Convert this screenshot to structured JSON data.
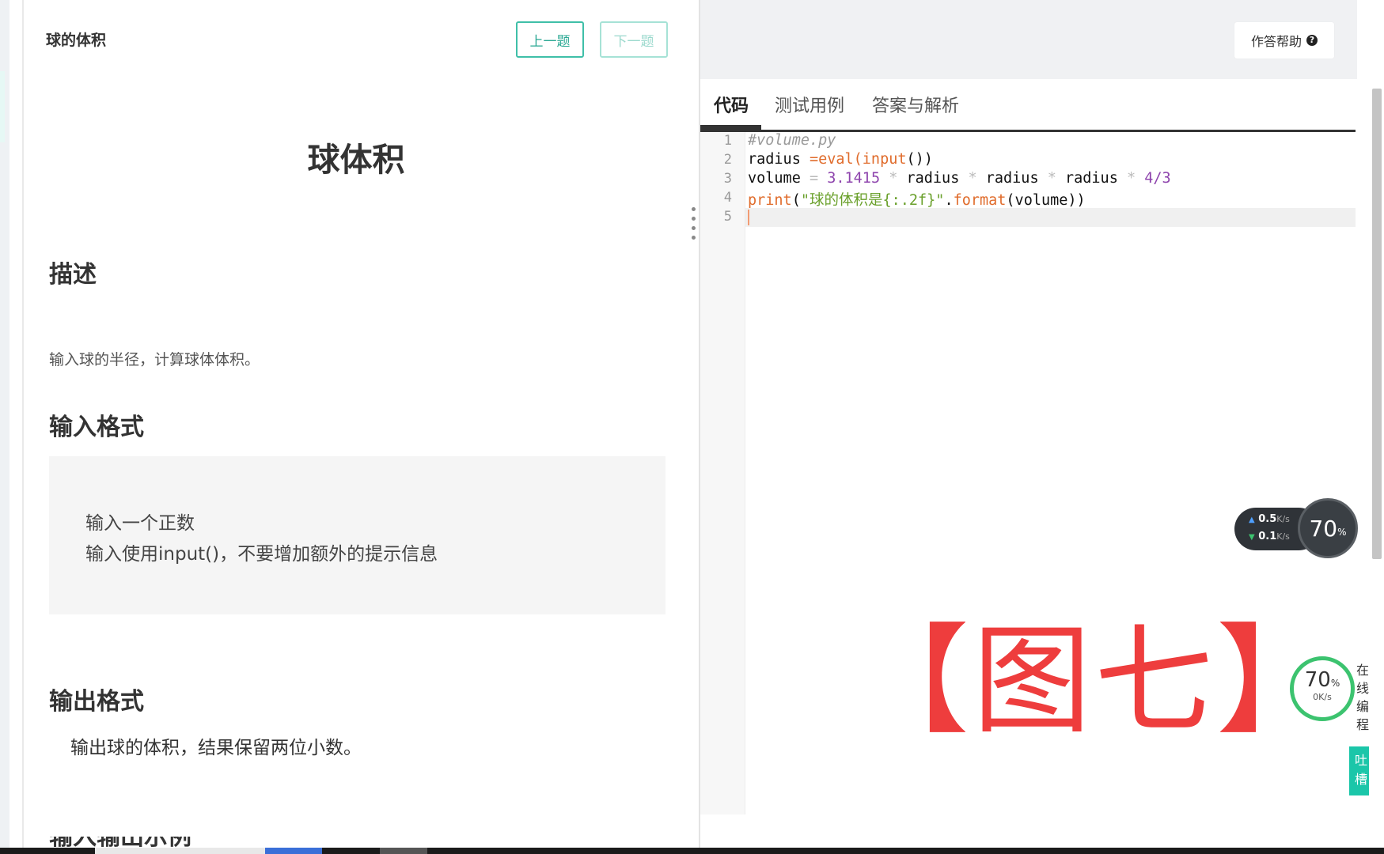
{
  "left": {
    "problem_title": "球的体积",
    "prev_label": "上一题",
    "next_label": "下一题",
    "content_title": "球体积",
    "desc_heading": "描述",
    "desc_text": "输入球的半径，计算球体体积。",
    "input_heading": "输入格式",
    "input_lines": [
      "输入一个正数",
      "输入使用input()，不要增加额外的提示信息"
    ],
    "output_heading": "输出格式",
    "output_text": "输出球的体积，结果保留两位小数。",
    "cut_heading": "输入输出示例"
  },
  "right": {
    "help_label": "作答帮助",
    "help_icon": "question-circle-icon",
    "tabs": [
      "代码",
      "测试用例",
      "答案与解析"
    ],
    "active_tab": 0,
    "line_numbers": [
      "1",
      "2",
      "3",
      "4",
      "5"
    ],
    "code": {
      "l1": "#volume.py",
      "l2_a": "radius ",
      "l2_b": "=eval(",
      "l2_c": "input",
      "l2_d": "())",
      "l3_a": "volume ",
      "l3_b": "= ",
      "l3_c": "3.1415",
      "l3_d": " * ",
      "l3_e": "radius",
      "l3_f": " * ",
      "l3_g": "radius",
      "l3_h": " * ",
      "l3_i": "radius",
      "l3_j": " * ",
      "l3_k": "4/3",
      "l4_a": "print",
      "l4_b": "(",
      "l4_c": "\"球的体积是{:.2f}\"",
      "l4_d": ".",
      "l4_e": "format",
      "l4_f": "(volume))"
    }
  },
  "watermark": "【图七】",
  "widgets": {
    "upload_speed": "0.5",
    "download_speed": "0.1",
    "speed_unit": "K/s",
    "cpu_percent": "70",
    "percent_sign": "%",
    "ring_percent": "70",
    "ring_speed": "0K/s",
    "online_label": "在线编程",
    "feedback_label": "吐槽"
  },
  "colors": {
    "accent": "#3fbfa8",
    "feedback": "#1bc6a9",
    "watermark": "#ee3d3d",
    "keyword": "#e06c2c",
    "number": "#8e44ad",
    "string": "#6aa02b"
  }
}
